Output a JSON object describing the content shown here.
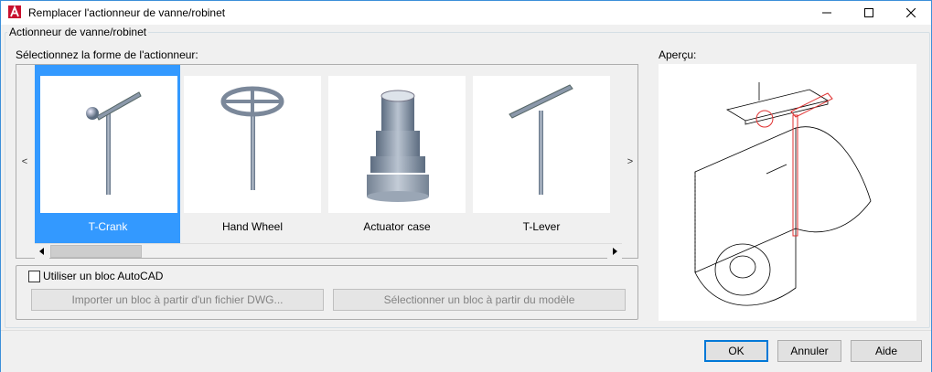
{
  "window": {
    "title": "Remplacer l'actionneur de vanne/robinet",
    "app_icon": "autocad-a-icon",
    "controls": {
      "minimize": "minimize-icon",
      "maximize": "maximize-icon",
      "close": "close-icon"
    }
  },
  "group": {
    "legend": "Actionneur de vanne/robinet",
    "shape_label": "Sélectionnez la forme de l'actionneur:",
    "preview_label": "Aperçu:"
  },
  "gallery": {
    "prev_arrow": "<",
    "next_arrow": ">",
    "selected_color": "#3399ff",
    "items": [
      {
        "label": "T-Crank",
        "icon": "t-crank-icon",
        "selected": true
      },
      {
        "label": "Hand Wheel",
        "icon": "hand-wheel-icon",
        "selected": false
      },
      {
        "label": "Actuator case",
        "icon": "actuator-case-icon",
        "selected": false
      },
      {
        "label": "T-Lever",
        "icon": "t-lever-icon",
        "selected": false
      }
    ]
  },
  "autocad_block": {
    "checkbox_label": "Utiliser un bloc AutoCAD",
    "checked": false,
    "import_button": "Importer un bloc à partir d'un fichier DWG...",
    "select_button": "Sélectionner un bloc à partir du modèle"
  },
  "buttons": {
    "ok": "OK",
    "cancel": "Annuler",
    "help": "Aide"
  },
  "colors": {
    "accent": "#0078d7",
    "preview_highlight": "#e03030"
  }
}
